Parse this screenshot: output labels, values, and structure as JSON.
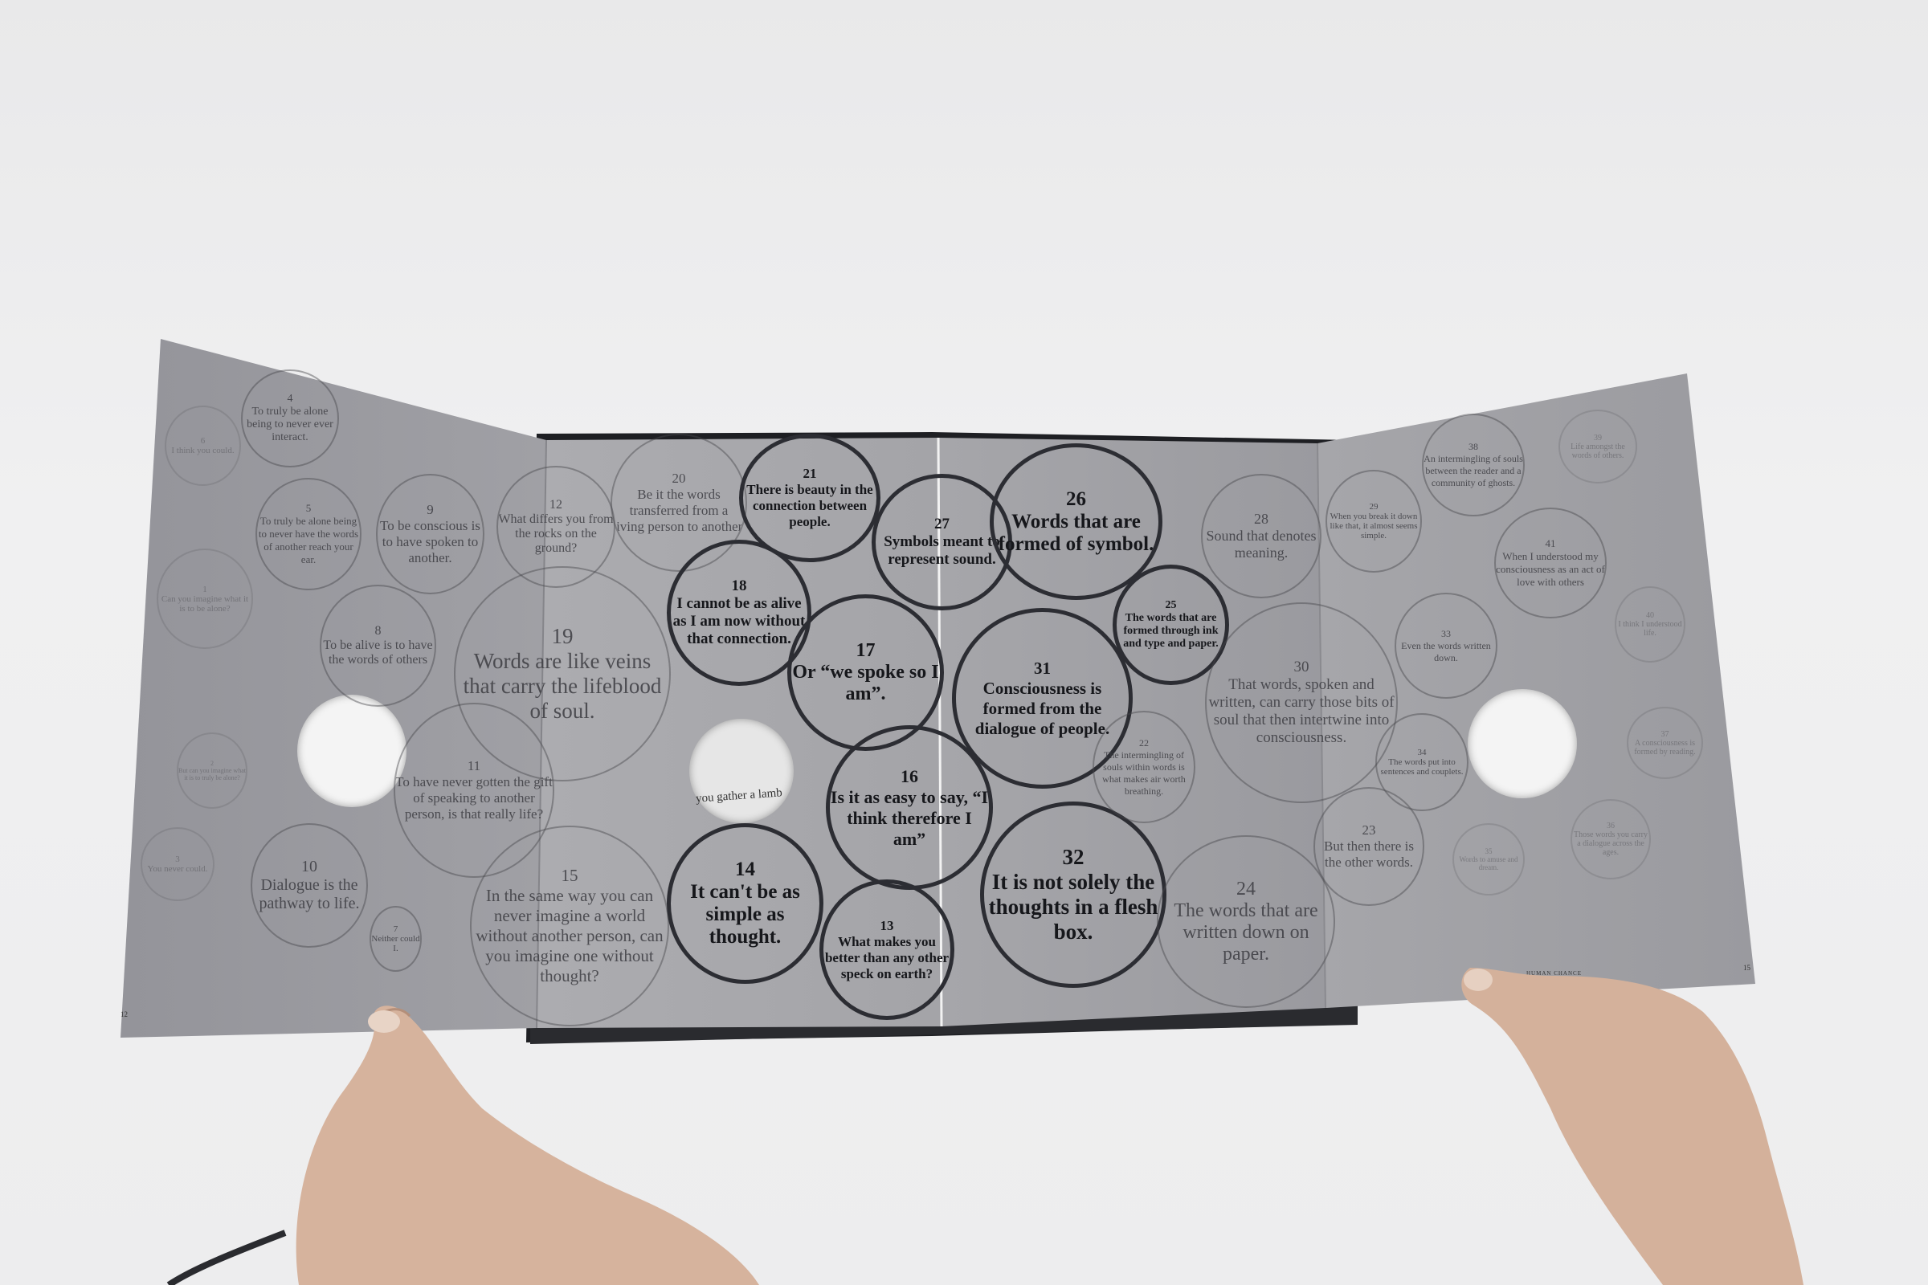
{
  "page_numbers": {
    "left": "12",
    "right": "15"
  },
  "running_head": "HUMAN CHANCE",
  "peek_text": "you gather a lamb",
  "bubbles": {
    "b4": {
      "num": "4",
      "text": "To truly be alone being to never ever interact."
    },
    "b5": {
      "num": "5",
      "text": "To truly be alone being to never have the words of another reach your ear."
    },
    "b6": {
      "num": "6",
      "text": "I think you could."
    },
    "b7": {
      "num": "7",
      "text": "Neither could I."
    },
    "b8": {
      "num": "8",
      "text": "To be alive is to have the words of others"
    },
    "b9": {
      "num": "9",
      "text": "To be conscious is to have spoken to another."
    },
    "b10": {
      "num": "10",
      "text": "Dialogue is the pathway to life."
    },
    "b11": {
      "num": "11",
      "text": "To have never gotten the gift of speaking to another person, is that really life?"
    },
    "b12": {
      "num": "12",
      "text": "What differs you from the rocks on the ground?"
    },
    "b13": {
      "num": "13",
      "text": "What makes you better than any other speck on earth?"
    },
    "b14": {
      "num": "14",
      "text": "It can't be as simple as thought."
    },
    "b15": {
      "num": "15",
      "text": "In the same way you can never imagine a world without another person, can you imagine one without thought?"
    },
    "b16": {
      "num": "16",
      "text": "Is it as easy to say, “I think therefore I am”"
    },
    "b17": {
      "num": "17",
      "text": "Or “we spoke so I am”."
    },
    "b18": {
      "num": "18",
      "text": "I cannot be as alive as I am now without that connection."
    },
    "b19": {
      "num": "19",
      "text": "Words are like veins that carry the lifeblood of soul."
    },
    "b20": {
      "num": "20",
      "text": "Be it the words transferred from a living person to another."
    },
    "b21": {
      "num": "21",
      "text": "There is beauty in the connection between people."
    },
    "b22": {
      "num": "22",
      "text": "The intermingling of souls within words is what makes air worth breathing."
    },
    "b23": {
      "num": "23",
      "text": "But then there is the other words."
    },
    "b24": {
      "num": "24",
      "text": "The words that are written down on paper."
    },
    "b25": {
      "num": "25",
      "text": "The words that are formed through ink and type and paper."
    },
    "b26": {
      "num": "26",
      "text": "Words that are formed of symbol."
    },
    "b27": {
      "num": "27",
      "text": "Symbols meant to represent sound."
    },
    "b28": {
      "num": "28",
      "text": "Sound that denotes meaning."
    },
    "b29": {
      "num": "29",
      "text": "When you break it down like that, it almost seems simple."
    },
    "b30": {
      "num": "30",
      "text": "That words, spoken and written, can carry those bits of soul that then intertwine into consciousness."
    },
    "b31": {
      "num": "31",
      "text": "Consciousness is formed from the dialogue of people."
    },
    "b32": {
      "num": "32",
      "text": "It is not solely the thoughts in a flesh box."
    },
    "b33": {
      "num": "33",
      "text": "Even the words written down."
    },
    "b34": {
      "num": "34",
      "text": "The words put into sentences and couplets."
    },
    "b35": {
      "num": "35",
      "text": "Words to amuse and dream."
    },
    "b36": {
      "num": "36",
      "text": "Those words you carry a dialogue across the ages."
    },
    "b37": {
      "num": "37",
      "text": "A consciousness is formed by reading."
    },
    "b38": {
      "num": "38",
      "text": "An intermingling of souls between the reader and a community of ghosts."
    },
    "b39": {
      "num": "39",
      "text": "Life amongst the words of others."
    },
    "b40": {
      "num": "40",
      "text": "I think I understood life."
    },
    "b41": {
      "num": "41",
      "text": "When I understood my consciousness as an act of love with others"
    },
    "b1": {
      "num": "1",
      "text": "Can you imagine what it is to be alone?"
    },
    "b2": {
      "num": "2",
      "text": "But can you imagine what it is to truly be alone?"
    },
    "b3": {
      "num": "3",
      "text": "You never could."
    }
  },
  "colors": {
    "wall": "#ececed",
    "page_gray": "#9c9ca0",
    "center_page": "#a9a9ad",
    "book_cover": "#1f2024",
    "ink": "#1a1b1f",
    "skin": "#d9b8a2"
  }
}
